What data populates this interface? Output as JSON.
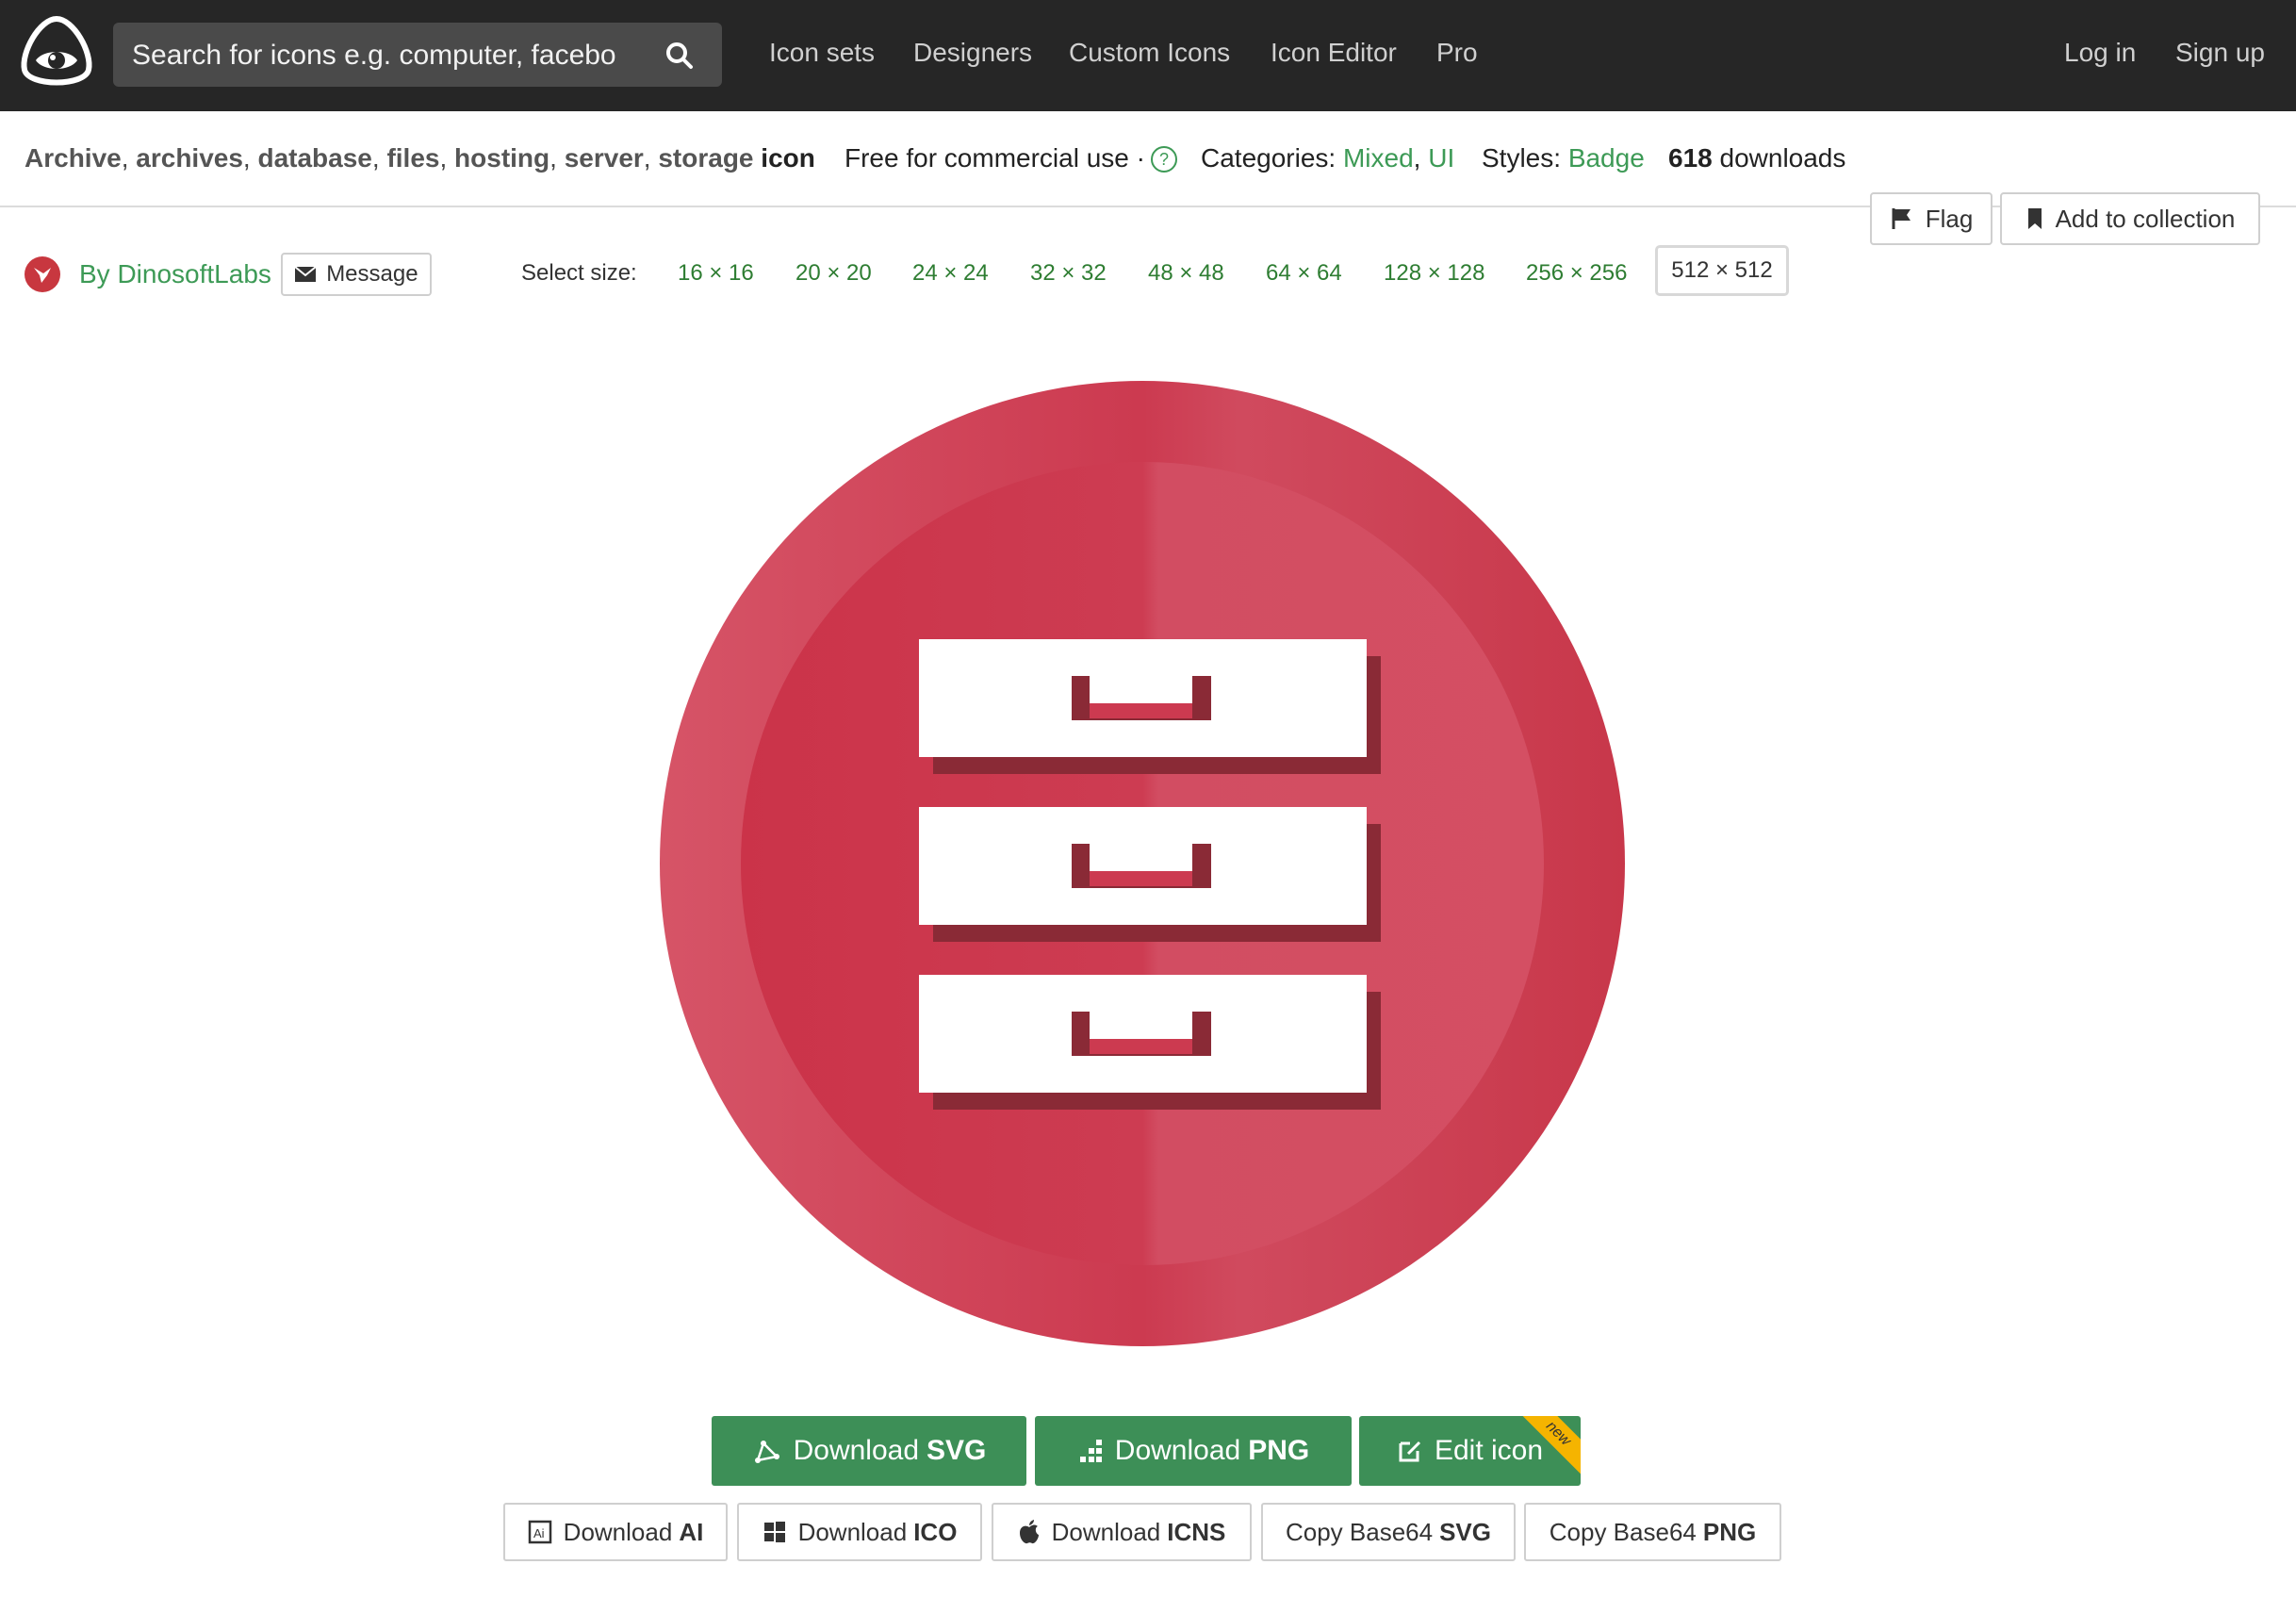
{
  "header": {
    "search_placeholder": "Search for icons e.g. computer, facebo",
    "nav": [
      "Icon sets",
      "Designers",
      "Custom Icons",
      "Icon Editor",
      "Pro"
    ],
    "login": "Log in",
    "signup": "Sign up"
  },
  "info": {
    "keywords": [
      "Archive",
      "archives",
      "database",
      "files",
      "hosting",
      "server",
      "storage"
    ],
    "icon_word": "icon",
    "license": "Free for commercial use ·",
    "license_help": "?",
    "categories_label": "Categories:",
    "categories": [
      "Mixed",
      "UI"
    ],
    "styles_label": "Styles:",
    "style": "Badge",
    "downloads_count": "618",
    "downloads_label": "downloads"
  },
  "actions": {
    "flag": "Flag",
    "add_collection": "Add to collection"
  },
  "author": {
    "by": "By DinosoftLabs",
    "message": "Message"
  },
  "sizes": {
    "label": "Select size:",
    "options": [
      "16 × 16",
      "20 × 20",
      "24 × 24",
      "32 × 32",
      "48 × 48",
      "64 × 64",
      "128 × 128",
      "256 × 256"
    ],
    "selected": "512 × 512"
  },
  "preview": {
    "icon_name": "archive-drawers-icon",
    "colors": {
      "badge": "#c8374a",
      "badge_light": "#d65467",
      "drawer": "#ffffff",
      "shadow": "#8a2a36"
    }
  },
  "downloads": {
    "svg": {
      "prefix": "Download",
      "bold": "SVG"
    },
    "png": {
      "prefix": "Download",
      "bold": "PNG"
    },
    "edit": "Edit icon",
    "edit_badge": "new",
    "ai": {
      "prefix": "Download",
      "bold": "AI"
    },
    "ico": {
      "prefix": "Download",
      "bold": "ICO"
    },
    "icns": {
      "prefix": "Download",
      "bold": "ICNS"
    },
    "b64svg": {
      "prefix": "Copy Base64",
      "bold": "SVG"
    },
    "b64png": {
      "prefix": "Copy Base64",
      "bold": "PNG"
    }
  },
  "theme": {
    "accent": "#3d8f57",
    "topbar": "#262626"
  }
}
